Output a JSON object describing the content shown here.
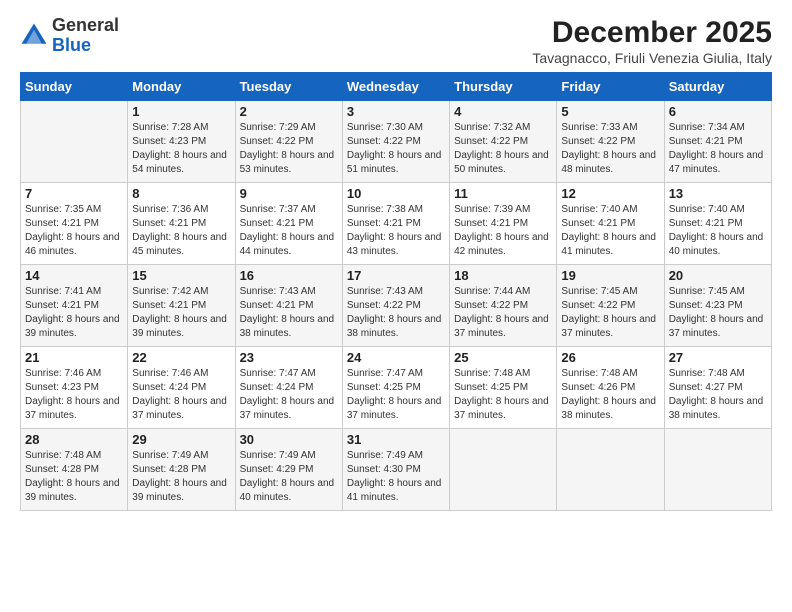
{
  "header": {
    "logo_general": "General",
    "logo_blue": "Blue",
    "month_title": "December 2025",
    "location": "Tavagnacco, Friuli Venezia Giulia, Italy"
  },
  "days_of_week": [
    "Sunday",
    "Monday",
    "Tuesday",
    "Wednesday",
    "Thursday",
    "Friday",
    "Saturday"
  ],
  "weeks": [
    [
      {
        "day": "",
        "sunrise": "",
        "sunset": "",
        "daylight": ""
      },
      {
        "day": "1",
        "sunrise": "Sunrise: 7:28 AM",
        "sunset": "Sunset: 4:23 PM",
        "daylight": "Daylight: 8 hours and 54 minutes."
      },
      {
        "day": "2",
        "sunrise": "Sunrise: 7:29 AM",
        "sunset": "Sunset: 4:22 PM",
        "daylight": "Daylight: 8 hours and 53 minutes."
      },
      {
        "day": "3",
        "sunrise": "Sunrise: 7:30 AM",
        "sunset": "Sunset: 4:22 PM",
        "daylight": "Daylight: 8 hours and 51 minutes."
      },
      {
        "day": "4",
        "sunrise": "Sunrise: 7:32 AM",
        "sunset": "Sunset: 4:22 PM",
        "daylight": "Daylight: 8 hours and 50 minutes."
      },
      {
        "day": "5",
        "sunrise": "Sunrise: 7:33 AM",
        "sunset": "Sunset: 4:22 PM",
        "daylight": "Daylight: 8 hours and 48 minutes."
      },
      {
        "day": "6",
        "sunrise": "Sunrise: 7:34 AM",
        "sunset": "Sunset: 4:21 PM",
        "daylight": "Daylight: 8 hours and 47 minutes."
      }
    ],
    [
      {
        "day": "7",
        "sunrise": "Sunrise: 7:35 AM",
        "sunset": "Sunset: 4:21 PM",
        "daylight": "Daylight: 8 hours and 46 minutes."
      },
      {
        "day": "8",
        "sunrise": "Sunrise: 7:36 AM",
        "sunset": "Sunset: 4:21 PM",
        "daylight": "Daylight: 8 hours and 45 minutes."
      },
      {
        "day": "9",
        "sunrise": "Sunrise: 7:37 AM",
        "sunset": "Sunset: 4:21 PM",
        "daylight": "Daylight: 8 hours and 44 minutes."
      },
      {
        "day": "10",
        "sunrise": "Sunrise: 7:38 AM",
        "sunset": "Sunset: 4:21 PM",
        "daylight": "Daylight: 8 hours and 43 minutes."
      },
      {
        "day": "11",
        "sunrise": "Sunrise: 7:39 AM",
        "sunset": "Sunset: 4:21 PM",
        "daylight": "Daylight: 8 hours and 42 minutes."
      },
      {
        "day": "12",
        "sunrise": "Sunrise: 7:40 AM",
        "sunset": "Sunset: 4:21 PM",
        "daylight": "Daylight: 8 hours and 41 minutes."
      },
      {
        "day": "13",
        "sunrise": "Sunrise: 7:40 AM",
        "sunset": "Sunset: 4:21 PM",
        "daylight": "Daylight: 8 hours and 40 minutes."
      }
    ],
    [
      {
        "day": "14",
        "sunrise": "Sunrise: 7:41 AM",
        "sunset": "Sunset: 4:21 PM",
        "daylight": "Daylight: 8 hours and 39 minutes."
      },
      {
        "day": "15",
        "sunrise": "Sunrise: 7:42 AM",
        "sunset": "Sunset: 4:21 PM",
        "daylight": "Daylight: 8 hours and 39 minutes."
      },
      {
        "day": "16",
        "sunrise": "Sunrise: 7:43 AM",
        "sunset": "Sunset: 4:21 PM",
        "daylight": "Daylight: 8 hours and 38 minutes."
      },
      {
        "day": "17",
        "sunrise": "Sunrise: 7:43 AM",
        "sunset": "Sunset: 4:22 PM",
        "daylight": "Daylight: 8 hours and 38 minutes."
      },
      {
        "day": "18",
        "sunrise": "Sunrise: 7:44 AM",
        "sunset": "Sunset: 4:22 PM",
        "daylight": "Daylight: 8 hours and 37 minutes."
      },
      {
        "day": "19",
        "sunrise": "Sunrise: 7:45 AM",
        "sunset": "Sunset: 4:22 PM",
        "daylight": "Daylight: 8 hours and 37 minutes."
      },
      {
        "day": "20",
        "sunrise": "Sunrise: 7:45 AM",
        "sunset": "Sunset: 4:23 PM",
        "daylight": "Daylight: 8 hours and 37 minutes."
      }
    ],
    [
      {
        "day": "21",
        "sunrise": "Sunrise: 7:46 AM",
        "sunset": "Sunset: 4:23 PM",
        "daylight": "Daylight: 8 hours and 37 minutes."
      },
      {
        "day": "22",
        "sunrise": "Sunrise: 7:46 AM",
        "sunset": "Sunset: 4:24 PM",
        "daylight": "Daylight: 8 hours and 37 minutes."
      },
      {
        "day": "23",
        "sunrise": "Sunrise: 7:47 AM",
        "sunset": "Sunset: 4:24 PM",
        "daylight": "Daylight: 8 hours and 37 minutes."
      },
      {
        "day": "24",
        "sunrise": "Sunrise: 7:47 AM",
        "sunset": "Sunset: 4:25 PM",
        "daylight": "Daylight: 8 hours and 37 minutes."
      },
      {
        "day": "25",
        "sunrise": "Sunrise: 7:48 AM",
        "sunset": "Sunset: 4:25 PM",
        "daylight": "Daylight: 8 hours and 37 minutes."
      },
      {
        "day": "26",
        "sunrise": "Sunrise: 7:48 AM",
        "sunset": "Sunset: 4:26 PM",
        "daylight": "Daylight: 8 hours and 38 minutes."
      },
      {
        "day": "27",
        "sunrise": "Sunrise: 7:48 AM",
        "sunset": "Sunset: 4:27 PM",
        "daylight": "Daylight: 8 hours and 38 minutes."
      }
    ],
    [
      {
        "day": "28",
        "sunrise": "Sunrise: 7:48 AM",
        "sunset": "Sunset: 4:28 PM",
        "daylight": "Daylight: 8 hours and 39 minutes."
      },
      {
        "day": "29",
        "sunrise": "Sunrise: 7:49 AM",
        "sunset": "Sunset: 4:28 PM",
        "daylight": "Daylight: 8 hours and 39 minutes."
      },
      {
        "day": "30",
        "sunrise": "Sunrise: 7:49 AM",
        "sunset": "Sunset: 4:29 PM",
        "daylight": "Daylight: 8 hours and 40 minutes."
      },
      {
        "day": "31",
        "sunrise": "Sunrise: 7:49 AM",
        "sunset": "Sunset: 4:30 PM",
        "daylight": "Daylight: 8 hours and 41 minutes."
      },
      {
        "day": "",
        "sunrise": "",
        "sunset": "",
        "daylight": ""
      },
      {
        "day": "",
        "sunrise": "",
        "sunset": "",
        "daylight": ""
      },
      {
        "day": "",
        "sunrise": "",
        "sunset": "",
        "daylight": ""
      }
    ]
  ]
}
